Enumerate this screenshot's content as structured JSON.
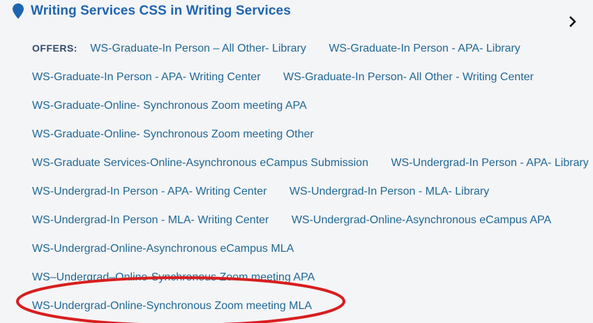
{
  "header": {
    "title": "Writing Services CSS in Writing Services",
    "pin_icon": "map-pin-icon",
    "chevron_icon": "chevron-right-icon",
    "accent_color": "#1f64b0"
  },
  "offers_label": "OFFERS:",
  "offers": [
    "WS-Graduate-In Person – All Other- Library",
    "WS-Graduate-In Person - APA- Library",
    "WS-Graduate-In Person - APA- Writing Center",
    "WS-Graduate-In Person- All Other - Writing Center",
    "WS-Graduate-Online- Synchronous Zoom meeting APA",
    "WS-Graduate-Online- Synchronous Zoom meeting Other",
    "WS-Graduate Services-Online-Asynchronous eCampus Submission",
    "WS-Undergrad-In Person - APA- Library",
    "WS-Undergrad-In Person - APA- Writing Center",
    "WS-Undergrad-In Person - MLA- Library",
    "WS-Undergrad-In Person - MLA- Writing Center",
    "WS-Undergrad-Online-Asynchronous eCampus APA",
    "WS-Undergrad-Online-Asynchronous eCampus MLA",
    "WS–Undergrad–Online-Synchronous Zoom meeting APA",
    "WS-Undergrad-Online-Synchronous Zoom meeting MLA"
  ],
  "link_color": "#226894",
  "highlight_color": "#d81e1e"
}
